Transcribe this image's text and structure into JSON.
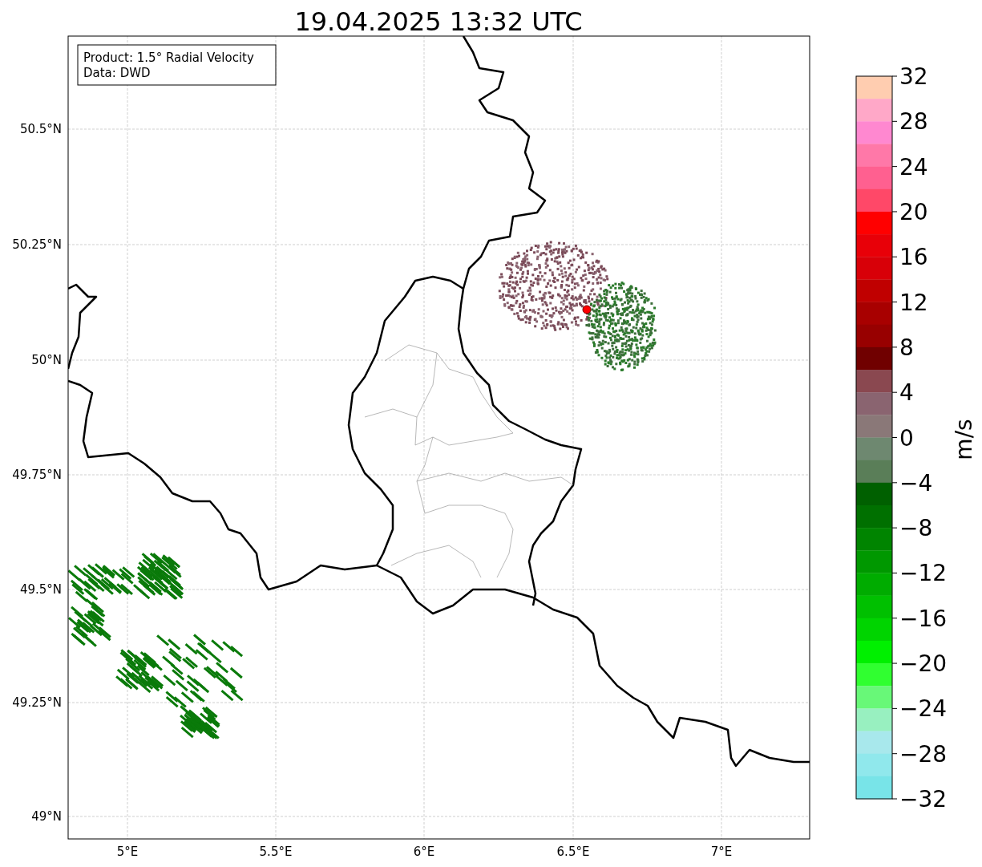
{
  "title": "19.04.2025 13:32 UTC",
  "info_box": [
    "Product: 1.5° Radial Velocity",
    "Data: DWD"
  ],
  "x_ticks": [
    "5°E",
    "5.5°E",
    "6°E",
    "6.5°E",
    "7°E"
  ],
  "y_ticks": [
    "50.5°N",
    "50.25°N",
    "50°N",
    "49.75°N",
    "49.5°N",
    "49.25°N",
    "49°N"
  ],
  "colorbar": {
    "label": "m/s",
    "ticks": [
      "32",
      "28",
      "24",
      "20",
      "16",
      "12",
      "8",
      "4",
      "0",
      "−4",
      "−8",
      "−12",
      "−16",
      "−20",
      "−24",
      "−28",
      "−32"
    ],
    "segments": [
      {
        "color": "#ffcdb0"
      },
      {
        "color": "#ffa8c8"
      },
      {
        "color": "#ff88d0"
      },
      {
        "color": "#ff78a8"
      },
      {
        "color": "#ff6090"
      },
      {
        "color": "#ff4868"
      },
      {
        "color": "#ff0000"
      },
      {
        "color": "#e80008"
      },
      {
        "color": "#d80008"
      },
      {
        "color": "#c00000"
      },
      {
        "color": "#a80000"
      },
      {
        "color": "#980000"
      },
      {
        "color": "#700000"
      },
      {
        "color": "#8a4850"
      },
      {
        "color": "#8a6470"
      },
      {
        "color": "#8a7878"
      },
      {
        "color": "#6e8870"
      },
      {
        "color": "#5a7e58"
      },
      {
        "color": "#006000"
      },
      {
        "color": "#007000"
      },
      {
        "color": "#008400"
      },
      {
        "color": "#009800"
      },
      {
        "color": "#00ac00"
      },
      {
        "color": "#00c000"
      },
      {
        "color": "#00d400"
      },
      {
        "color": "#00f000"
      },
      {
        "color": "#30ff30"
      },
      {
        "color": "#68f878"
      },
      {
        "color": "#98f0c0"
      },
      {
        "color": "#a8e8ec"
      },
      {
        "color": "#90e8ec"
      },
      {
        "color": "#78e4e8"
      }
    ]
  }
}
